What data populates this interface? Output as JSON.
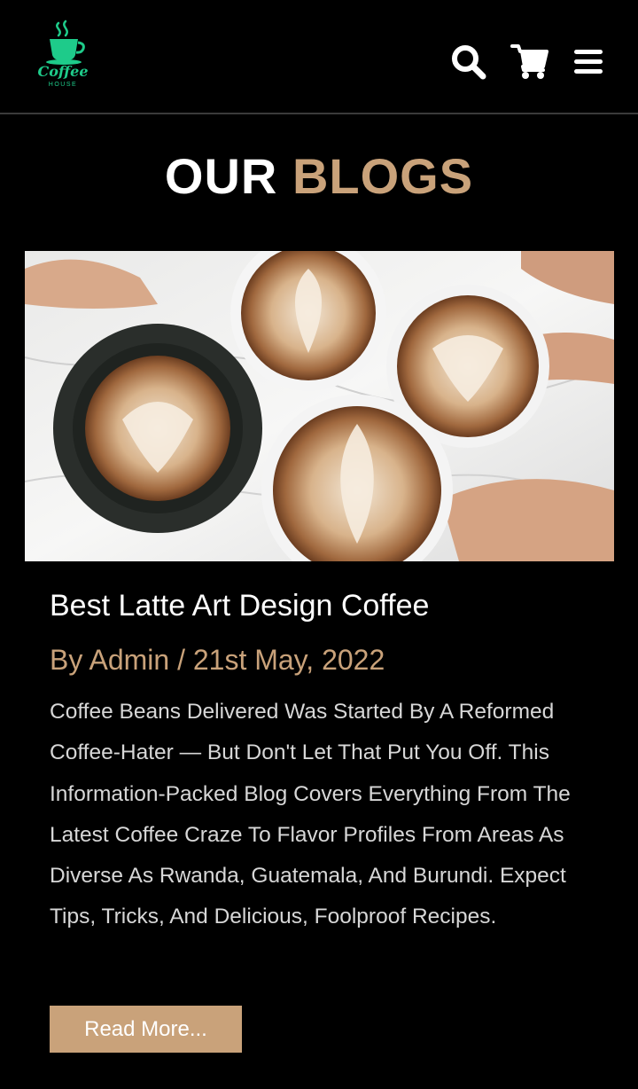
{
  "header": {
    "logo": {
      "line1": "Coffee",
      "line2": "HOUSE",
      "color": "#1ecb8a"
    },
    "icons": {
      "search": "search-icon",
      "cart": "cart-icon",
      "menu": "hamburger-menu-icon"
    }
  },
  "section": {
    "title_part1": "OUR",
    "title_part2": "BLOGS"
  },
  "post": {
    "image": "latte-art-cups-image",
    "title": "Best Latte Art Design Coffee",
    "meta": "By Admin / 21st May, 2022",
    "body": "Coffee Beans Delivered Was Started By A Reformed Coffee-Hater — But Don't Let That Put You Off. This Information-Packed Blog Covers Everything From The Latest Coffee Craze To Flavor Profiles From Areas As Diverse As Rwanda, Guatemala, And Burundi. Expect Tips, Tricks, And Delicious, Foolproof Recipes.",
    "read_more_label": "Read More..."
  },
  "colors": {
    "background": "#000000",
    "accent": "#c9a27a",
    "logo_green": "#1ecb8a"
  }
}
